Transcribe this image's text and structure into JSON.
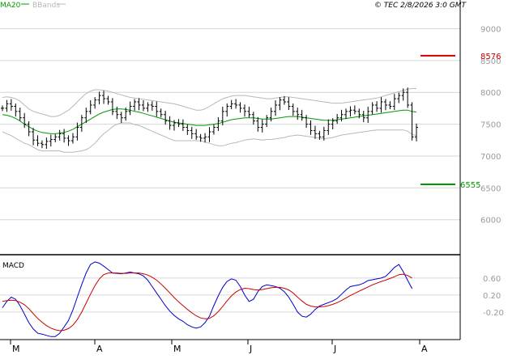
{
  "legend": {
    "ma20_label": "MA20",
    "bbands_label": "BBands",
    "ma20_color": "#009900",
    "bbands_color": "#b8b8b8"
  },
  "copyright": "© TEC 2/8/2026 3:0 GMT",
  "macd_title": "MACD",
  "chart_data": [
    {
      "type": "candlestick",
      "title": "",
      "ylim": [
        5450,
        9450
      ],
      "y_ticks": [
        {
          "value": 9000,
          "label": "9000"
        },
        {
          "value": 8500,
          "label": "8500"
        },
        {
          "value": 8000,
          "label": "8000"
        },
        {
          "value": 7500,
          "label": "7500"
        },
        {
          "value": 7000,
          "label": "7000"
        },
        {
          "value": 6500,
          "label": "6500"
        },
        {
          "value": 6000,
          "label": "6000"
        }
      ],
      "x_labels": [
        "M",
        "A",
        "M",
        "J",
        "J",
        "A"
      ],
      "levels": [
        {
          "value": 8576,
          "label": "8576",
          "color": "#cc0000"
        },
        {
          "value": 6555,
          "label": "6555",
          "color": "#009900"
        }
      ],
      "close": [
        7750,
        7820,
        7780,
        7700,
        7600,
        7500,
        7380,
        7250,
        7200,
        7180,
        7230,
        7260,
        7300,
        7350,
        7280,
        7240,
        7300,
        7450,
        7600,
        7700,
        7800,
        7880,
        7950,
        7900,
        7850,
        7700,
        7650,
        7600,
        7700,
        7780,
        7850,
        7800,
        7750,
        7800,
        7780,
        7700,
        7650,
        7550,
        7480,
        7520,
        7500,
        7450,
        7400,
        7350,
        7300,
        7280,
        7300,
        7380,
        7450,
        7550,
        7700,
        7780,
        7820,
        7800,
        7750,
        7700,
        7650,
        7550,
        7450,
        7500,
        7600,
        7700,
        7800,
        7880,
        7850,
        7780,
        7700,
        7650,
        7600,
        7500,
        7400,
        7350,
        7300,
        7400,
        7500,
        7550,
        7600,
        7650,
        7700,
        7720,
        7700,
        7650,
        7600,
        7700,
        7800,
        7750,
        7850,
        7800,
        7780,
        7900,
        7950,
        8000,
        7800,
        7300,
        7450
      ],
      "ma20": [
        7650,
        7640,
        7620,
        7590,
        7550,
        7500,
        7460,
        7420,
        7390,
        7370,
        7360,
        7350,
        7350,
        7360,
        7370,
        7390,
        7420,
        7460,
        7500,
        7540,
        7580,
        7620,
        7660,
        7690,
        7710,
        7730,
        7740,
        7740,
        7730,
        7720,
        7700,
        7690,
        7670,
        7650,
        7630,
        7610,
        7590,
        7570,
        7550,
        7530,
        7520,
        7510,
        7500,
        7490,
        7480,
        7480,
        7480,
        7490,
        7500,
        7510,
        7530,
        7550,
        7570,
        7580,
        7590,
        7600,
        7600,
        7600,
        7590,
        7580,
        7580,
        7580,
        7590,
        7600,
        7610,
        7620,
        7620,
        7620,
        7610,
        7600,
        7590,
        7580,
        7570,
        7560,
        7560,
        7560,
        7570,
        7580,
        7590,
        7600,
        7610,
        7620,
        7630,
        7640,
        7650,
        7660,
        7670,
        7680,
        7690,
        7700,
        7710,
        7720,
        7720,
        7700,
        7690
      ],
      "bb_upper": [
        7920,
        7930,
        7920,
        7900,
        7860,
        7800,
        7740,
        7700,
        7680,
        7660,
        7640,
        7620,
        7620,
        7640,
        7680,
        7720,
        7780,
        7850,
        7920,
        7980,
        8020,
        8040,
        8040,
        8030,
        8020,
        8000,
        7980,
        7960,
        7940,
        7920,
        7910,
        7900,
        7890,
        7880,
        7870,
        7860,
        7850,
        7840,
        7830,
        7820,
        7800,
        7780,
        7760,
        7740,
        7720,
        7720,
        7740,
        7780,
        7820,
        7860,
        7900,
        7920,
        7940,
        7950,
        7950,
        7950,
        7940,
        7930,
        7920,
        7910,
        7900,
        7900,
        7910,
        7920,
        7930,
        7930,
        7920,
        7910,
        7900,
        7890,
        7880,
        7870,
        7860,
        7850,
        7840,
        7830,
        7830,
        7830,
        7840,
        7850,
        7860,
        7870,
        7880,
        7890,
        7900,
        7910,
        7930,
        7950,
        7970,
        7990,
        8010,
        8030,
        8050,
        8060,
        8060
      ],
      "bb_lower": [
        7380,
        7350,
        7320,
        7280,
        7240,
        7200,
        7180,
        7140,
        7100,
        7080,
        7080,
        7080,
        7080,
        7080,
        7060,
        7060,
        7060,
        7070,
        7080,
        7100,
        7140,
        7200,
        7280,
        7350,
        7400,
        7460,
        7500,
        7520,
        7520,
        7520,
        7490,
        7480,
        7450,
        7420,
        7390,
        7360,
        7330,
        7300,
        7270,
        7240,
        7240,
        7240,
        7240,
        7240,
        7240,
        7240,
        7220,
        7200,
        7180,
        7160,
        7160,
        7180,
        7200,
        7210,
        7230,
        7250,
        7260,
        7270,
        7260,
        7250,
        7260,
        7260,
        7270,
        7280,
        7290,
        7310,
        7320,
        7330,
        7320,
        7310,
        7300,
        7290,
        7280,
        7270,
        7280,
        7290,
        7310,
        7330,
        7340,
        7350,
        7360,
        7370,
        7380,
        7390,
        7400,
        7410,
        7410,
        7410,
        7410,
        7410,
        7410,
        7410,
        7390,
        7340,
        7320
      ]
    },
    {
      "type": "line",
      "title": "MACD",
      "ylim": [
        -0.85,
        1.15
      ],
      "y_ticks": [
        {
          "value": 0.6,
          "label": "0.60"
        },
        {
          "value": 0.2,
          "label": "0.20"
        },
        {
          "value": -0.2,
          "label": "-0.20"
        }
      ],
      "series": [
        {
          "color": "#0000cc",
          "values": [
            -0.1,
            0.05,
            0.15,
            0.1,
            -0.05,
            -0.25,
            -0.45,
            -0.6,
            -0.7,
            -0.72,
            -0.75,
            -0.78,
            -0.78,
            -0.7,
            -0.55,
            -0.4,
            -0.15,
            0.15,
            0.45,
            0.72,
            0.92,
            0.98,
            0.95,
            0.88,
            0.8,
            0.72,
            0.71,
            0.7,
            0.72,
            0.74,
            0.72,
            0.7,
            0.65,
            0.55,
            0.4,
            0.25,
            0.1,
            -0.05,
            -0.18,
            -0.28,
            -0.36,
            -0.42,
            -0.5,
            -0.55,
            -0.58,
            -0.55,
            -0.45,
            -0.3,
            -0.05,
            0.18,
            0.38,
            0.52,
            0.58,
            0.55,
            0.4,
            0.2,
            0.05,
            0.1,
            0.28,
            0.4,
            0.44,
            0.42,
            0.4,
            0.36,
            0.28,
            0.15,
            -0.02,
            -0.2,
            -0.3,
            -0.32,
            -0.25,
            -0.14,
            -0.06,
            -0.02,
            0.02,
            0.06,
            0.12,
            0.22,
            0.32,
            0.4,
            0.42,
            0.44,
            0.48,
            0.54,
            0.56,
            0.58,
            0.6,
            0.64,
            0.74,
            0.85,
            0.92,
            0.75,
            0.55,
            0.35
          ]
        },
        {
          "color": "#cc0000",
          "values": [
            0.05,
            0.07,
            0.08,
            0.07,
            0.03,
            -0.03,
            -0.12,
            -0.24,
            -0.35,
            -0.44,
            -0.52,
            -0.58,
            -0.62,
            -0.64,
            -0.63,
            -0.59,
            -0.51,
            -0.38,
            -0.2,
            0.01,
            0.22,
            0.42,
            0.58,
            0.68,
            0.72,
            0.72,
            0.72,
            0.71,
            0.71,
            0.72,
            0.72,
            0.72,
            0.7,
            0.67,
            0.62,
            0.55,
            0.46,
            0.36,
            0.25,
            0.14,
            0.04,
            -0.05,
            -0.14,
            -0.22,
            -0.29,
            -0.34,
            -0.36,
            -0.35,
            -0.29,
            -0.19,
            -0.07,
            0.06,
            0.18,
            0.27,
            0.33,
            0.36,
            0.35,
            0.33,
            0.32,
            0.33,
            0.35,
            0.37,
            0.38,
            0.38,
            0.36,
            0.32,
            0.25,
            0.15,
            0.06,
            -0.02,
            -0.06,
            -0.08,
            -0.08,
            -0.07,
            -0.05,
            -0.02,
            0.02,
            0.07,
            0.13,
            0.19,
            0.24,
            0.29,
            0.34,
            0.39,
            0.44,
            0.48,
            0.52,
            0.55,
            0.59,
            0.63,
            0.68,
            0.69,
            0.66,
            0.6
          ]
        }
      ]
    }
  ]
}
